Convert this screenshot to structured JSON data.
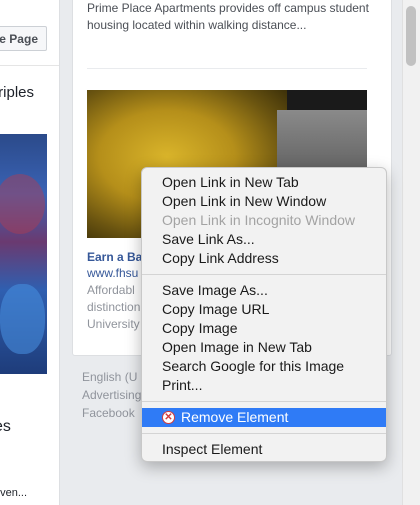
{
  "feed": {
    "like_page_label": "e Page",
    "post_text": "triples",
    "post_text_2": "es",
    "post_text_3": "even..."
  },
  "ads": {
    "ad1_description": "Prime Place Apartments provides off campus student housing located within walking distance...",
    "ad2_title": "Earn a Ba",
    "ad2_url": "www.fhsu",
    "ad2_description_lines": [
      "Affordabl",
      "distinction",
      "University"
    ]
  },
  "footer": {
    "line1": "English (U",
    "line2": "Advertising",
    "line3": "Facebook"
  },
  "context_menu": {
    "group1": [
      {
        "label": "Open Link in New Tab",
        "disabled": false
      },
      {
        "label": "Open Link in New Window",
        "disabled": false
      },
      {
        "label": "Open Link in Incognito Window",
        "disabled": true
      },
      {
        "label": "Save Link As...",
        "disabled": false
      },
      {
        "label": "Copy Link Address",
        "disabled": false
      }
    ],
    "group2": [
      {
        "label": "Save Image As...",
        "disabled": false
      },
      {
        "label": "Copy Image URL",
        "disabled": false
      },
      {
        "label": "Copy Image",
        "disabled": false
      },
      {
        "label": "Open Image in New Tab",
        "disabled": false
      },
      {
        "label": "Search Google for this Image",
        "disabled": false
      },
      {
        "label": "Print...",
        "disabled": false
      }
    ],
    "remove_element": {
      "label": "Remove Element",
      "icon": "remove-circle-icon"
    },
    "inspect_element": {
      "label": "Inspect Element"
    }
  },
  "colors": {
    "highlight": "#2f7bf6",
    "link": "#365899",
    "remove_icon": "#d43c3c"
  }
}
